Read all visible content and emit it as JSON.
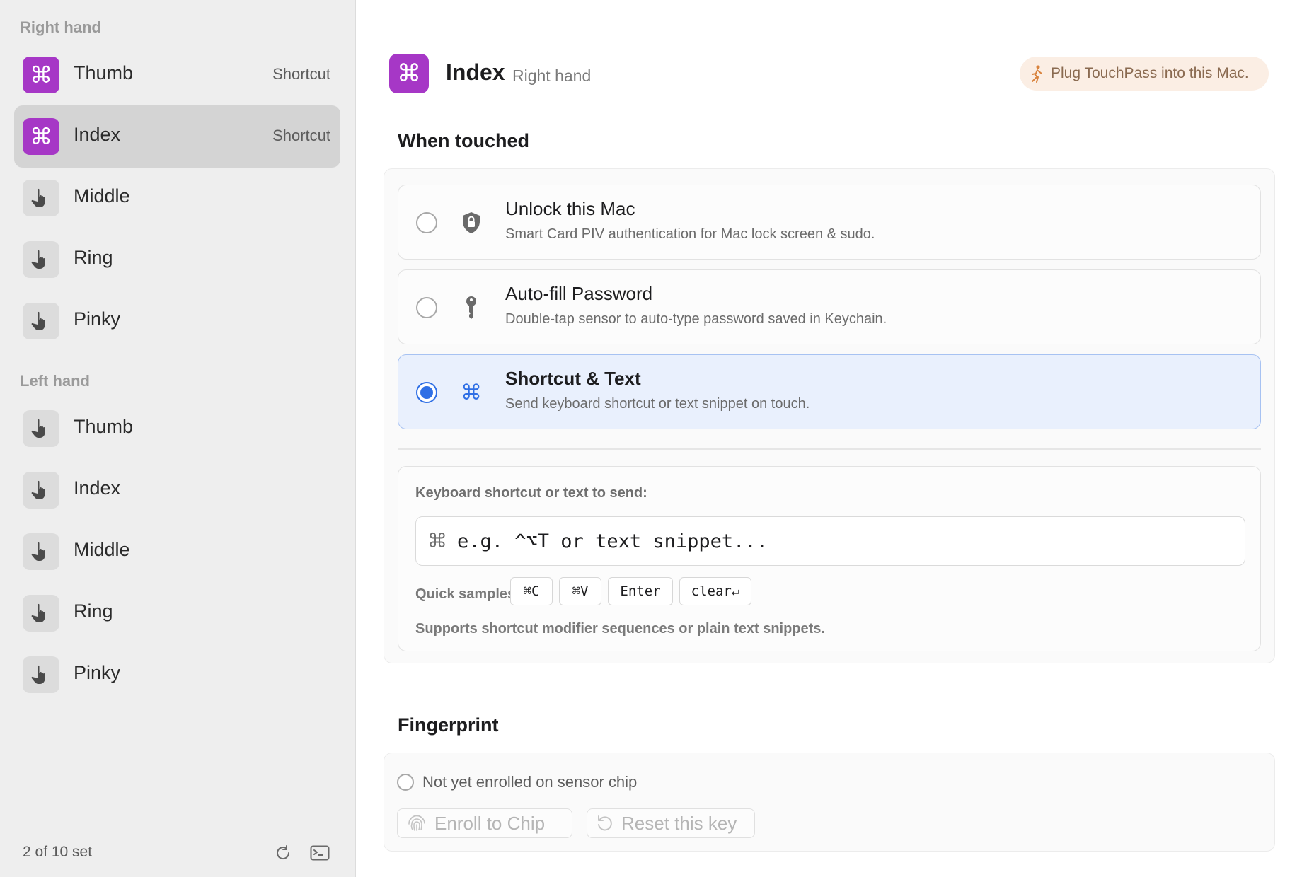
{
  "sidebar": {
    "right_header": "Right hand",
    "left_header": "Left hand",
    "right_items": [
      {
        "label": "Thumb",
        "badge": "Shortcut",
        "icon": "command-icon"
      },
      {
        "label": "Index",
        "badge": "Shortcut",
        "icon": "command-icon"
      },
      {
        "label": "Middle",
        "badge": "",
        "icon": "hand-pointer-icon"
      },
      {
        "label": "Ring",
        "badge": "",
        "icon": "hand-pointer-icon"
      },
      {
        "label": "Pinky",
        "badge": "",
        "icon": "hand-pointer-icon"
      }
    ],
    "left_items": [
      {
        "label": "Thumb",
        "icon": "hand-pointer-icon"
      },
      {
        "label": "Index",
        "icon": "hand-pointer-icon"
      },
      {
        "label": "Middle",
        "icon": "hand-pointer-icon"
      },
      {
        "label": "Ring",
        "icon": "hand-pointer-icon"
      },
      {
        "label": "Pinky",
        "icon": "hand-pointer-icon"
      }
    ],
    "footer_status": "2 of 10 set",
    "footer_icons": [
      "refresh-icon",
      "terminal-icon"
    ]
  },
  "header": {
    "glyph": "⌘",
    "title": "Index",
    "subtitle": "Right hand",
    "notice": "Plug TouchPass into this Mac."
  },
  "when_touched": {
    "title": "When touched",
    "options": [
      {
        "title": "Unlock this Mac",
        "desc": "Smart Card PIV authentication for Mac lock screen & sudo.",
        "icon": "lock-shield-icon",
        "selected": false
      },
      {
        "title": "Auto-fill Password",
        "desc": "Double-tap sensor to auto-type password saved in Keychain.",
        "icon": "key-icon",
        "selected": false
      },
      {
        "title": "Shortcut & Text",
        "desc": "Send keyboard shortcut or text snippet on touch.",
        "icon": "command-icon",
        "selected": true
      }
    ],
    "shortcut": {
      "label": "Keyboard shortcut or text to send:",
      "glyph": "⌘",
      "placeholder": "e.g. ^⌥T or text snippet...",
      "value": "",
      "quick_label": "Quick samples:",
      "samples": [
        "⌘C",
        "⌘V",
        "Enter",
        "clear↵"
      ],
      "hint": "Supports shortcut modifier sequences or plain text snippets."
    }
  },
  "fingerprint": {
    "title": "Fingerprint",
    "status": "Not yet enrolled on sensor chip",
    "enroll_label": "Enroll to Chip",
    "reset_label": "Reset this key"
  },
  "colors": {
    "accent_purple": "#a637c6",
    "selected_blue": "#2f6fe5",
    "selected_bg": "#e9f0fd",
    "notice_bg": "#fbeee4"
  }
}
